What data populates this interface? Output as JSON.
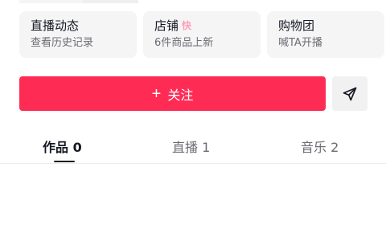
{
  "cards": [
    {
      "title": "直播动态",
      "subtitle": "查看历史记录"
    },
    {
      "title": "店铺",
      "badge": "快",
      "subtitle": "6件商品上新"
    },
    {
      "title": "购物团",
      "subtitle": "喊TA开播"
    }
  ],
  "actions": {
    "follow_label": "关注",
    "plus_icon": "+"
  },
  "tabs": [
    {
      "label": "作品 0",
      "active": true
    },
    {
      "label": "直播 1",
      "active": false
    },
    {
      "label": "音乐 2",
      "active": false
    }
  ],
  "colors": {
    "accent": "#fe2c55",
    "text": "#161823",
    "subtext": "#6b6c73",
    "card_bg": "#f5f5f6"
  },
  "icons": [
    "plus-icon",
    "send-icon",
    "shop-badge-icon"
  ]
}
